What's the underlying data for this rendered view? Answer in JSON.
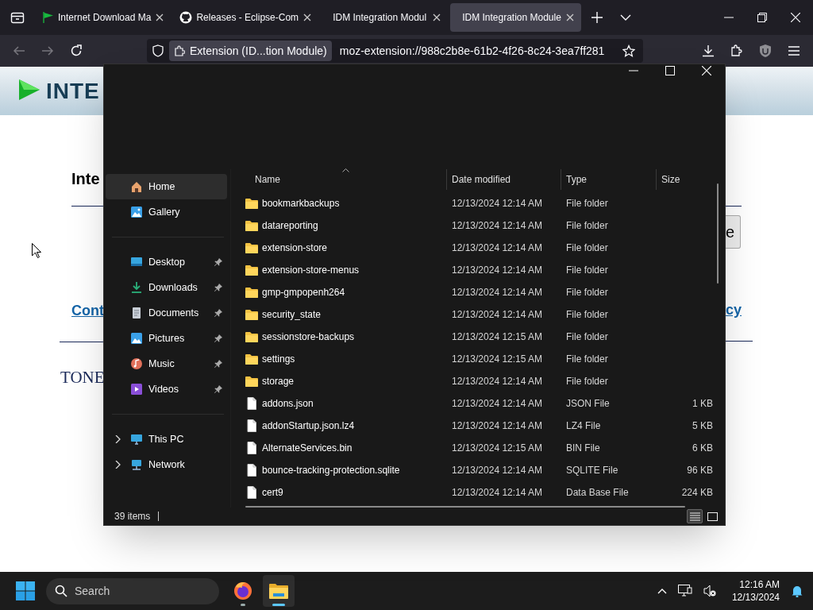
{
  "browser": {
    "tabs": [
      {
        "title": "Internet Download Ma",
        "kind": "flag",
        "selected": false
      },
      {
        "title": "Releases - Eclipse-Com",
        "kind": "github",
        "selected": false
      },
      {
        "title": "IDM Integration Modul",
        "kind": "none",
        "selected": false
      },
      {
        "title": "IDM Integration Module",
        "kind": "none",
        "selected": true
      }
    ],
    "identity": "Extension (ID...tion Module)",
    "url": "moz-extension://988c2b8e-61b2-4f26-8c24-3ea7ff281"
  },
  "web_page": {
    "logo": "INTE",
    "heading": "Inte",
    "button": "e",
    "link_left": "Cont",
    "link_right": "cy",
    "footer_logo": "TONE"
  },
  "explorer": {
    "sidebar_sections": [
      {
        "items": [
          {
            "label": "Home",
            "kind": "home",
            "selected": true
          },
          {
            "label": "Gallery",
            "kind": "gallery",
            "selected": false
          }
        ]
      },
      {
        "items": [
          {
            "label": "Desktop",
            "kind": "desktop",
            "selected": false,
            "pinned": true
          },
          {
            "label": "Downloads",
            "kind": "downloads",
            "selected": false,
            "pinned": true
          },
          {
            "label": "Documents",
            "kind": "documents",
            "selected": false,
            "pinned": true
          },
          {
            "label": "Pictures",
            "kind": "pictures",
            "selected": false,
            "pinned": true
          },
          {
            "label": "Music",
            "kind": "music",
            "selected": false,
            "pinned": true
          },
          {
            "label": "Videos",
            "kind": "videos",
            "selected": false,
            "pinned": true
          }
        ]
      },
      {
        "items": [
          {
            "label": "This PC",
            "kind": "pc",
            "selected": false,
            "expanded": false
          },
          {
            "label": "Network",
            "kind": "network",
            "selected": false,
            "expanded": false
          }
        ]
      }
    ],
    "columns": [
      {
        "label": "Name",
        "sorted": true
      },
      {
        "label": "Date modified",
        "sorted": false
      },
      {
        "label": "Type",
        "sorted": false
      },
      {
        "label": "Size",
        "sorted": false
      }
    ],
    "rows": [
      {
        "kind": "folder",
        "name": "bookmarkbackups",
        "date": "12/13/2024 12:14 AM",
        "type": "File folder"
      },
      {
        "kind": "folder",
        "name": "datareporting",
        "date": "12/13/2024 12:14 AM",
        "type": "File folder"
      },
      {
        "kind": "folder",
        "name": "extension-store",
        "date": "12/13/2024 12:14 AM",
        "type": "File folder"
      },
      {
        "kind": "folder",
        "name": "extension-store-menus",
        "date": "12/13/2024 12:14 AM",
        "type": "File folder"
      },
      {
        "kind": "folder",
        "name": "gmp-gmpopenh264",
        "date": "12/13/2024 12:14 AM",
        "type": "File folder"
      },
      {
        "kind": "folder",
        "name": "security_state",
        "date": "12/13/2024 12:14 AM",
        "type": "File folder"
      },
      {
        "kind": "folder",
        "name": "sessionstore-backups",
        "date": "12/13/2024 12:15 AM",
        "type": "File folder"
      },
      {
        "kind": "folder",
        "name": "settings",
        "date": "12/13/2024 12:15 AM",
        "type": "File folder"
      },
      {
        "kind": "folder",
        "name": "storage",
        "date": "12/13/2024 12:14 AM",
        "type": "File folder"
      },
      {
        "kind": "file",
        "name": "addons.json",
        "date": "12/13/2024 12:14 AM",
        "type": "JSON File",
        "size": "1 KB"
      },
      {
        "kind": "file",
        "name": "addonStartup.json.lz4",
        "date": "12/13/2024 12:14 AM",
        "type": "LZ4 File",
        "size": "5 KB"
      },
      {
        "kind": "file",
        "name": "AlternateServices.bin",
        "date": "12/13/2024 12:15 AM",
        "type": "BIN File",
        "size": "6 KB"
      },
      {
        "kind": "file",
        "name": "bounce-tracking-protection.sqlite",
        "date": "12/13/2024 12:14 AM",
        "type": "SQLITE File",
        "size": "96 KB"
      },
      {
        "kind": "file",
        "name": "cert9",
        "date": "12/13/2024 12:14 AM",
        "type": "Data Base File",
        "size": "224 KB"
      }
    ],
    "status": "39 items",
    "views": [
      {
        "kind": "details",
        "selected": true
      },
      {
        "kind": "tiles",
        "selected": false
      }
    ]
  },
  "taskbar": {
    "search_placeholder": "Search",
    "apps": [
      {
        "kind": "firefox",
        "active": false
      },
      {
        "kind": "explorer",
        "active": true
      }
    ],
    "time": "12:16 AM",
    "date": "12/13/2024"
  }
}
